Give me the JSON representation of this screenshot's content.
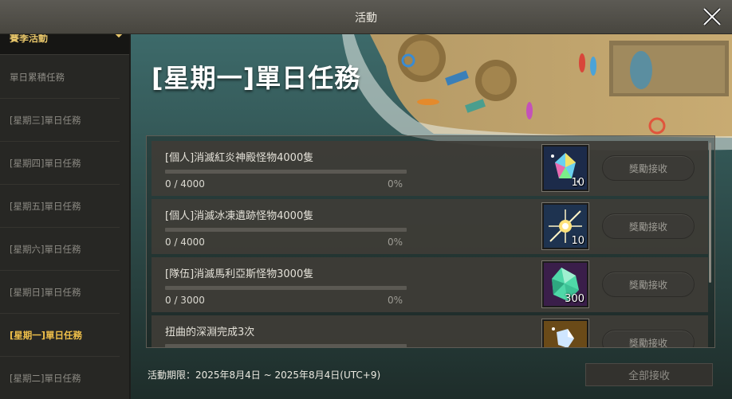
{
  "window": {
    "title": "活動"
  },
  "sidebar": {
    "active_top_label": "賽季活動",
    "items": [
      {
        "label": "單日累積任務",
        "active": false
      },
      {
        "label": "[星期三]單日任務",
        "active": false
      },
      {
        "label": "[星期四]單日任務",
        "active": false
      },
      {
        "label": "[星期五]單日任務",
        "active": false
      },
      {
        "label": "[星期六]單日任務",
        "active": false
      },
      {
        "label": "[星期日]單日任務",
        "active": false
      },
      {
        "label": "[星期一]單日任務",
        "active": true
      },
      {
        "label": "[星期二]單日任務",
        "active": false
      }
    ]
  },
  "main": {
    "heading": "[星期一]單日任務",
    "quests": [
      {
        "name": "[個人]消滅紅炎神殿怪物4000隻",
        "progress": "0 / 4000",
        "percent": "0%",
        "progress_fraction": 0,
        "reward_icon": "rainbow-crystal-icon",
        "reward_count": "10",
        "claim_label": "獎勵接收"
      },
      {
        "name": "[個人]消滅冰凍遺跡怪物4000隻",
        "progress": "0 / 4000",
        "percent": "0%",
        "progress_fraction": 0,
        "reward_icon": "star-burst-icon",
        "reward_count": "10",
        "claim_label": "獎勵接收"
      },
      {
        "name": "[隊伍]消滅馬利亞斯怪物3000隻",
        "progress": "0 / 3000",
        "percent": "0%",
        "progress_fraction": 0,
        "reward_icon": "green-gem-icon",
        "reward_count": "300",
        "claim_label": "獎勵接收"
      },
      {
        "name": "扭曲的深淵完成3次",
        "progress": "",
        "percent": "",
        "progress_fraction": 0,
        "reward_icon": "ice-crystal-icon",
        "reward_count": "",
        "claim_label": "獎勵接收"
      }
    ],
    "period": "活動期限：2025年8月4日 ~ 2025年8月4日(UTC+9)",
    "claim_all_label": "全部接收"
  },
  "colors": {
    "accent": "#f0c04a",
    "panel": "#3e3c37",
    "sidebar": "#272724"
  }
}
